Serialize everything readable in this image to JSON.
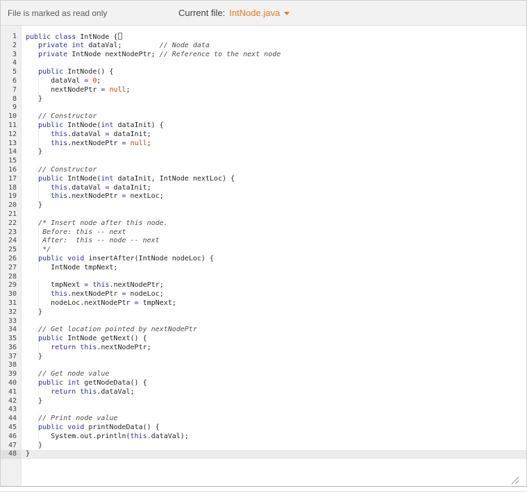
{
  "header": {
    "read_only_text": "File is marked as read only",
    "current_file_label": "Current file:",
    "file_name": "IntNode.java"
  },
  "colors": {
    "accent": "#ee7d17",
    "keyword": "#2c2cb0",
    "comment": "#4e4e4e",
    "constant": "#b5420e",
    "header_bg": "#f2f2f2",
    "gutter_bg": "#f0f0f0",
    "active_line_bg": "#ececec"
  },
  "editor": {
    "language": "java",
    "active_line": 48,
    "lines": [
      {
        "num": 1,
        "cursor": true,
        "tokens": [
          [
            "k",
            "public"
          ],
          [
            "p",
            " "
          ],
          [
            "k",
            "class"
          ],
          [
            "p",
            " IntNode {"
          ]
        ]
      },
      {
        "num": 2,
        "tokens": [
          [
            "p",
            "   "
          ],
          [
            "k",
            "private"
          ],
          [
            "p",
            " "
          ],
          [
            "k",
            "int"
          ],
          [
            "p",
            " dataVal;         "
          ],
          [
            "c",
            "// Node data"
          ]
        ]
      },
      {
        "num": 3,
        "tokens": [
          [
            "p",
            "   "
          ],
          [
            "k",
            "private"
          ],
          [
            "p",
            " IntNode nextNodePtr; "
          ],
          [
            "c",
            "// Reference to the next node"
          ]
        ]
      },
      {
        "num": 4,
        "tokens": []
      },
      {
        "num": 5,
        "tokens": [
          [
            "p",
            "   "
          ],
          [
            "k",
            "public"
          ],
          [
            "p",
            " IntNode() {"
          ]
        ]
      },
      {
        "num": 6,
        "tokens": [
          [
            "p",
            "      dataVal "
          ],
          [
            "k",
            "="
          ],
          [
            "p",
            " "
          ],
          [
            "n",
            "0"
          ],
          [
            "p",
            ";"
          ]
        ]
      },
      {
        "num": 7,
        "tokens": [
          [
            "p",
            "      nextNodePtr "
          ],
          [
            "k",
            "="
          ],
          [
            "p",
            " "
          ],
          [
            "n",
            "null"
          ],
          [
            "p",
            ";"
          ]
        ]
      },
      {
        "num": 8,
        "tokens": [
          [
            "p",
            "   }"
          ]
        ]
      },
      {
        "num": 9,
        "tokens": []
      },
      {
        "num": 10,
        "tokens": [
          [
            "p",
            "   "
          ],
          [
            "c",
            "// Constructor"
          ]
        ]
      },
      {
        "num": 11,
        "tokens": [
          [
            "p",
            "   "
          ],
          [
            "k",
            "public"
          ],
          [
            "p",
            " IntNode("
          ],
          [
            "k",
            "int"
          ],
          [
            "p",
            " dataInit) {"
          ]
        ]
      },
      {
        "num": 12,
        "tokens": [
          [
            "p",
            "      "
          ],
          [
            "k",
            "this"
          ],
          [
            "p",
            ".dataVal "
          ],
          [
            "k",
            "="
          ],
          [
            "p",
            " dataInit;"
          ]
        ]
      },
      {
        "num": 13,
        "tokens": [
          [
            "p",
            "      "
          ],
          [
            "k",
            "this"
          ],
          [
            "p",
            ".nextNodePtr "
          ],
          [
            "k",
            "="
          ],
          [
            "p",
            " "
          ],
          [
            "n",
            "null"
          ],
          [
            "p",
            ";"
          ]
        ]
      },
      {
        "num": 14,
        "tokens": [
          [
            "p",
            "   }"
          ]
        ]
      },
      {
        "num": 15,
        "tokens": []
      },
      {
        "num": 16,
        "tokens": [
          [
            "p",
            "   "
          ],
          [
            "c",
            "// Constructor"
          ]
        ]
      },
      {
        "num": 17,
        "tokens": [
          [
            "p",
            "   "
          ],
          [
            "k",
            "public"
          ],
          [
            "p",
            " IntNode("
          ],
          [
            "k",
            "int"
          ],
          [
            "p",
            " dataInit, IntNode nextLoc) {"
          ]
        ]
      },
      {
        "num": 18,
        "tokens": [
          [
            "p",
            "      "
          ],
          [
            "k",
            "this"
          ],
          [
            "p",
            ".dataVal "
          ],
          [
            "k",
            "="
          ],
          [
            "p",
            " dataInit;"
          ]
        ]
      },
      {
        "num": 19,
        "tokens": [
          [
            "p",
            "      "
          ],
          [
            "k",
            "this"
          ],
          [
            "p",
            ".nextNodePtr "
          ],
          [
            "k",
            "="
          ],
          [
            "p",
            " nextLoc;"
          ]
        ]
      },
      {
        "num": 20,
        "tokens": [
          [
            "p",
            "   }"
          ]
        ]
      },
      {
        "num": 21,
        "tokens": []
      },
      {
        "num": 22,
        "tokens": [
          [
            "p",
            "   "
          ],
          [
            "c",
            "/* Insert node after this node."
          ]
        ]
      },
      {
        "num": 23,
        "tokens": [
          [
            "c",
            "    Before: this -- next"
          ]
        ]
      },
      {
        "num": 24,
        "tokens": [
          [
            "c",
            "    After:  this -- node -- next"
          ]
        ]
      },
      {
        "num": 25,
        "tokens": [
          [
            "c",
            "    */"
          ]
        ]
      },
      {
        "num": 26,
        "tokens": [
          [
            "p",
            "   "
          ],
          [
            "k",
            "public"
          ],
          [
            "p",
            " "
          ],
          [
            "k",
            "void"
          ],
          [
            "p",
            " insertAfter(IntNode nodeLoc) {"
          ]
        ]
      },
      {
        "num": 27,
        "tokens": [
          [
            "p",
            "      IntNode tmpNext;"
          ]
        ]
      },
      {
        "num": 28,
        "tokens": []
      },
      {
        "num": 29,
        "tokens": [
          [
            "p",
            "      tmpNext "
          ],
          [
            "k",
            "="
          ],
          [
            "p",
            " "
          ],
          [
            "k",
            "this"
          ],
          [
            "p",
            ".nextNodePtr;"
          ]
        ]
      },
      {
        "num": 30,
        "tokens": [
          [
            "p",
            "      "
          ],
          [
            "k",
            "this"
          ],
          [
            "p",
            ".nextNodePtr "
          ],
          [
            "k",
            "="
          ],
          [
            "p",
            " nodeLoc;"
          ]
        ]
      },
      {
        "num": 31,
        "tokens": [
          [
            "p",
            "      nodeLoc.nextNodePtr "
          ],
          [
            "k",
            "="
          ],
          [
            "p",
            " tmpNext;"
          ]
        ]
      },
      {
        "num": 32,
        "tokens": [
          [
            "p",
            "   }"
          ]
        ]
      },
      {
        "num": 33,
        "tokens": []
      },
      {
        "num": 34,
        "tokens": [
          [
            "p",
            "   "
          ],
          [
            "c",
            "// Get location pointed by nextNodePtr"
          ]
        ]
      },
      {
        "num": 35,
        "tokens": [
          [
            "p",
            "   "
          ],
          [
            "k",
            "public"
          ],
          [
            "p",
            " IntNode getNext() {"
          ]
        ]
      },
      {
        "num": 36,
        "tokens": [
          [
            "p",
            "      "
          ],
          [
            "k",
            "return"
          ],
          [
            "p",
            " "
          ],
          [
            "k",
            "this"
          ],
          [
            "p",
            ".nextNodePtr;"
          ]
        ]
      },
      {
        "num": 37,
        "tokens": [
          [
            "p",
            "   }"
          ]
        ]
      },
      {
        "num": 38,
        "tokens": []
      },
      {
        "num": 39,
        "tokens": [
          [
            "p",
            "   "
          ],
          [
            "c",
            "// Get node value"
          ]
        ]
      },
      {
        "num": 40,
        "tokens": [
          [
            "p",
            "   "
          ],
          [
            "k",
            "public"
          ],
          [
            "p",
            " "
          ],
          [
            "k",
            "int"
          ],
          [
            "p",
            " getNodeData() {"
          ]
        ]
      },
      {
        "num": 41,
        "tokens": [
          [
            "p",
            "      "
          ],
          [
            "k",
            "return"
          ],
          [
            "p",
            " "
          ],
          [
            "k",
            "this"
          ],
          [
            "p",
            ".dataVal;"
          ]
        ]
      },
      {
        "num": 42,
        "tokens": [
          [
            "p",
            "   }"
          ]
        ]
      },
      {
        "num": 43,
        "tokens": []
      },
      {
        "num": 44,
        "tokens": [
          [
            "p",
            "   "
          ],
          [
            "c",
            "// Print node value"
          ]
        ]
      },
      {
        "num": 45,
        "tokens": [
          [
            "p",
            "   "
          ],
          [
            "k",
            "public"
          ],
          [
            "p",
            " "
          ],
          [
            "k",
            "void"
          ],
          [
            "p",
            " printNodeData() {"
          ]
        ]
      },
      {
        "num": 46,
        "tokens": [
          [
            "p",
            "      System.out.println("
          ],
          [
            "k",
            "this"
          ],
          [
            "p",
            ".dataVal);"
          ]
        ]
      },
      {
        "num": 47,
        "tokens": [
          [
            "p",
            "   }"
          ]
        ]
      },
      {
        "num": 48,
        "active": true,
        "tokens": [
          [
            "p",
            "}"
          ]
        ]
      }
    ]
  }
}
